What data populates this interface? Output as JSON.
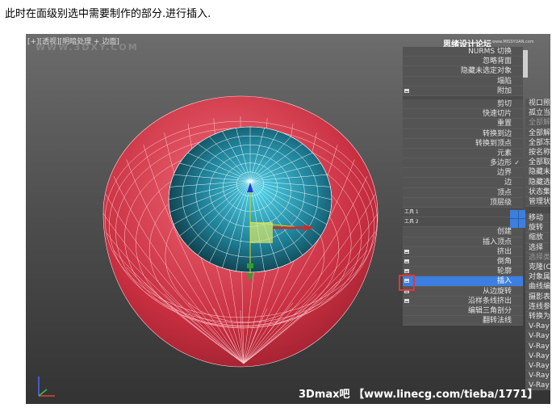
{
  "caption": "此时在面级别选中需要制作的部分.进行插入.",
  "viewport": {
    "label": "[+][透视][明暗处理 + 边面]",
    "watermark": "WWW.3DXY.COM",
    "brand": "思绪设计论坛",
    "brand_sub": "www.MISSYUAN.com",
    "site_watermark": "3Dmax吧 【www.linecg.com/tieba/1771】"
  },
  "quad_menu_left": [
    {
      "label": "NURMS 切换"
    },
    {
      "label": "忽略背面"
    },
    {
      "label": "隐藏未选定对象"
    },
    {
      "label": "塌陷"
    },
    {
      "label": "附加",
      "box": true
    },
    {
      "sep": true
    },
    {
      "label": "剪切"
    },
    {
      "label": "快速切片"
    },
    {
      "label": "重置"
    },
    {
      "label": "转换到边"
    },
    {
      "label": "转换到顶点"
    },
    {
      "label": "元素"
    },
    {
      "label": "多边形",
      "check": "✓"
    },
    {
      "label": "边界"
    },
    {
      "label": "边"
    },
    {
      "label": "顶点"
    },
    {
      "label": "顶层级"
    },
    {
      "tool": "工具 1"
    },
    {
      "tool": "工具 2"
    },
    {
      "label": "创建"
    },
    {
      "label": "插入顶点"
    },
    {
      "label": "挤出",
      "box": true
    },
    {
      "label": "倒角",
      "box": true
    },
    {
      "label": "轮廓",
      "box": true
    },
    {
      "label": "插入",
      "box": true,
      "hl": true
    },
    {
      "label": "从边旋转",
      "box": true
    },
    {
      "label": "沿样条线挤出",
      "box": true
    },
    {
      "label": "编辑三角剖分"
    },
    {
      "label": "翻转法线"
    }
  ],
  "quad_menu_right": [
    {
      "label": "视口照"
    },
    {
      "label": "孤立当"
    },
    {
      "label": "全部解",
      "dim": true
    },
    {
      "label": "全部解"
    },
    {
      "label": "全部冻"
    },
    {
      "label": "按名称"
    },
    {
      "label": "全部取"
    },
    {
      "label": "隐藏未"
    },
    {
      "label": "隐藏选"
    },
    {
      "label": "状态集"
    },
    {
      "label": "管理状"
    },
    {
      "sep": true
    },
    {
      "sep": true
    },
    {
      "label": "移动"
    },
    {
      "label": "旋转"
    },
    {
      "label": "缩放"
    },
    {
      "label": "选择"
    },
    {
      "label": "选择类",
      "dim": true
    },
    {
      "label": "克隆(C"
    },
    {
      "label": "对象属"
    },
    {
      "label": "曲线编"
    },
    {
      "label": "摄影表"
    },
    {
      "label": "连线参"
    },
    {
      "label": "转换为"
    },
    {
      "label": "V-Ray"
    },
    {
      "label": "V-Ray"
    },
    {
      "label": "V-Ray"
    },
    {
      "label": "V-Ray"
    },
    {
      "label": "V-Ray"
    },
    {
      "label": "V-Ray"
    },
    {
      "label": "V-Ray"
    }
  ]
}
